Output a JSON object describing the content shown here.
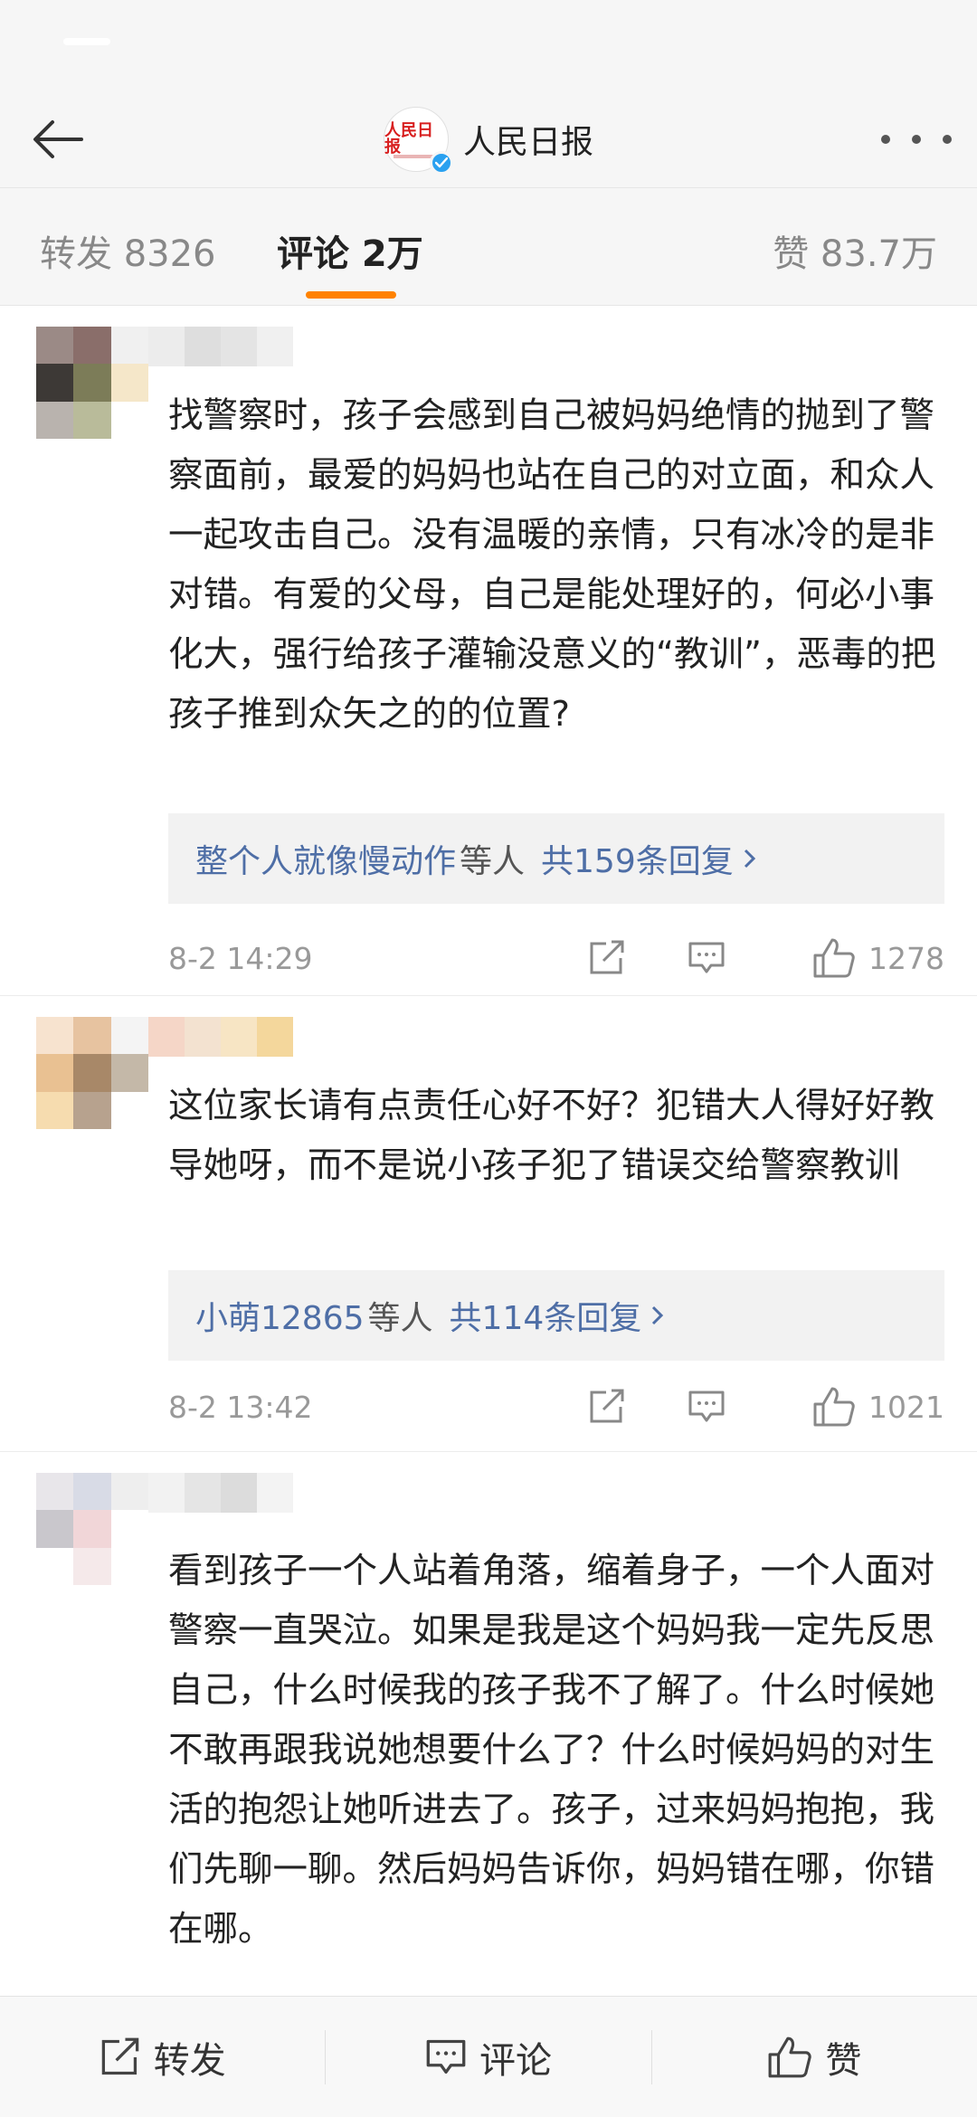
{
  "header": {
    "account_name": "人民日报",
    "avatar_text": "人民日报"
  },
  "tabs": {
    "repost": "转发 8326",
    "comments": "评论 2万",
    "likes": "赞 83.7万"
  },
  "comments": [
    {
      "text": "找警察时，孩子会感到自己被妈妈绝情的抛到了警察面前，最爱的妈妈也站在自己的对立面，和众人一起攻击自己。没有温暖的亲情，只有冰冷的是非对错。有爱的父母，自己是能处理好的，何必小事化大，强行给孩子灌输没意义的“教训”，恶毒的把孩子推到众矢之的的位置?",
      "reply_user": "整个人就像慢动作",
      "reply_mid": "等人",
      "reply_count": "共159条回复",
      "time": "8-2 14:29",
      "likes": "1278"
    },
    {
      "text": "这位家长请有点责任心好不好？犯错大人得好好教导她呀，而不是说小孩子犯了错误交给警察教训",
      "reply_user": "小萌12865",
      "reply_mid": "等人",
      "reply_count": "共114条回复",
      "time": "8-2 13:42",
      "likes": "1021"
    },
    {
      "text": "看到孩子一个人站着角落，缩着身子，一个人面对警察一直哭泣。如果是我是这个妈妈我一定先反思自己，什么时候我的孩子我不了解了。什么时候她不敢再跟我说她想要什么了？什么时候妈妈的对生活的抱怨让她听进去了。孩子，过来妈妈抱抱，我们先聊一聊。然后妈妈告诉你，妈妈错在哪，你错在哪。"
    }
  ],
  "bottom_bar": {
    "repost": "转发",
    "comment": "评论",
    "like": "赞"
  },
  "colors": {
    "accent": "#ff8200",
    "link": "#4e6ea6",
    "verified": "#2aa1f0",
    "brand_red": "#d81e1e"
  }
}
